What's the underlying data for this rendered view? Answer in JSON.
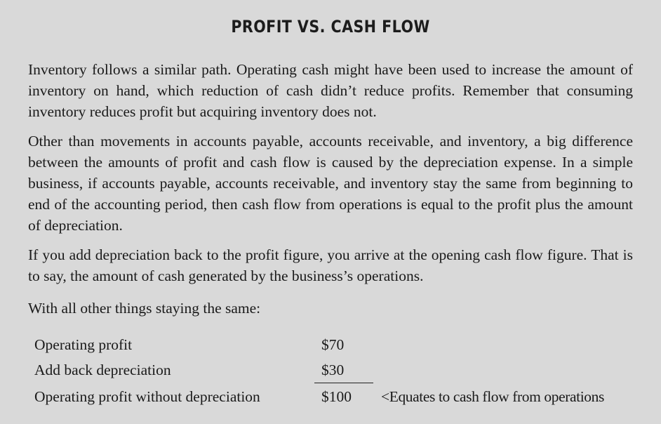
{
  "title": "PROFIT VS. CASH FLOW",
  "paragraphs": [
    "Inventory follows a similar path. Operating cash might have been used to increase the amount of inventory on hand, which reduction of cash didn’t reduce profits. Remember that consuming inventory reduces profit but acquiring inventory does not.",
    "Other than movements in accounts payable, accounts receivable, and inventory, a big difference between the amounts of profit and cash flow is caused by the depreciation expense. In a simple business, if accounts payable, accounts receivable, and inventory stay the same from beginning to end of the accounting period, then cash flow from operations is equal to the profit plus the amount of depreciation.",
    "If you add depreciation back to the profit figure, you arrive at the opening cash flow figure. That is to say, the amount of cash generated by the business’s operations.",
    "With all other things staying the same:"
  ],
  "calculation": {
    "rows": [
      {
        "label": "Operating profit",
        "amount": "$70"
      },
      {
        "label": "Add back depreciation",
        "amount": "$30"
      },
      {
        "label": "Operating profit without depreciation",
        "amount": "$100"
      }
    ],
    "note": "<Equates to cash flow from operations"
  }
}
